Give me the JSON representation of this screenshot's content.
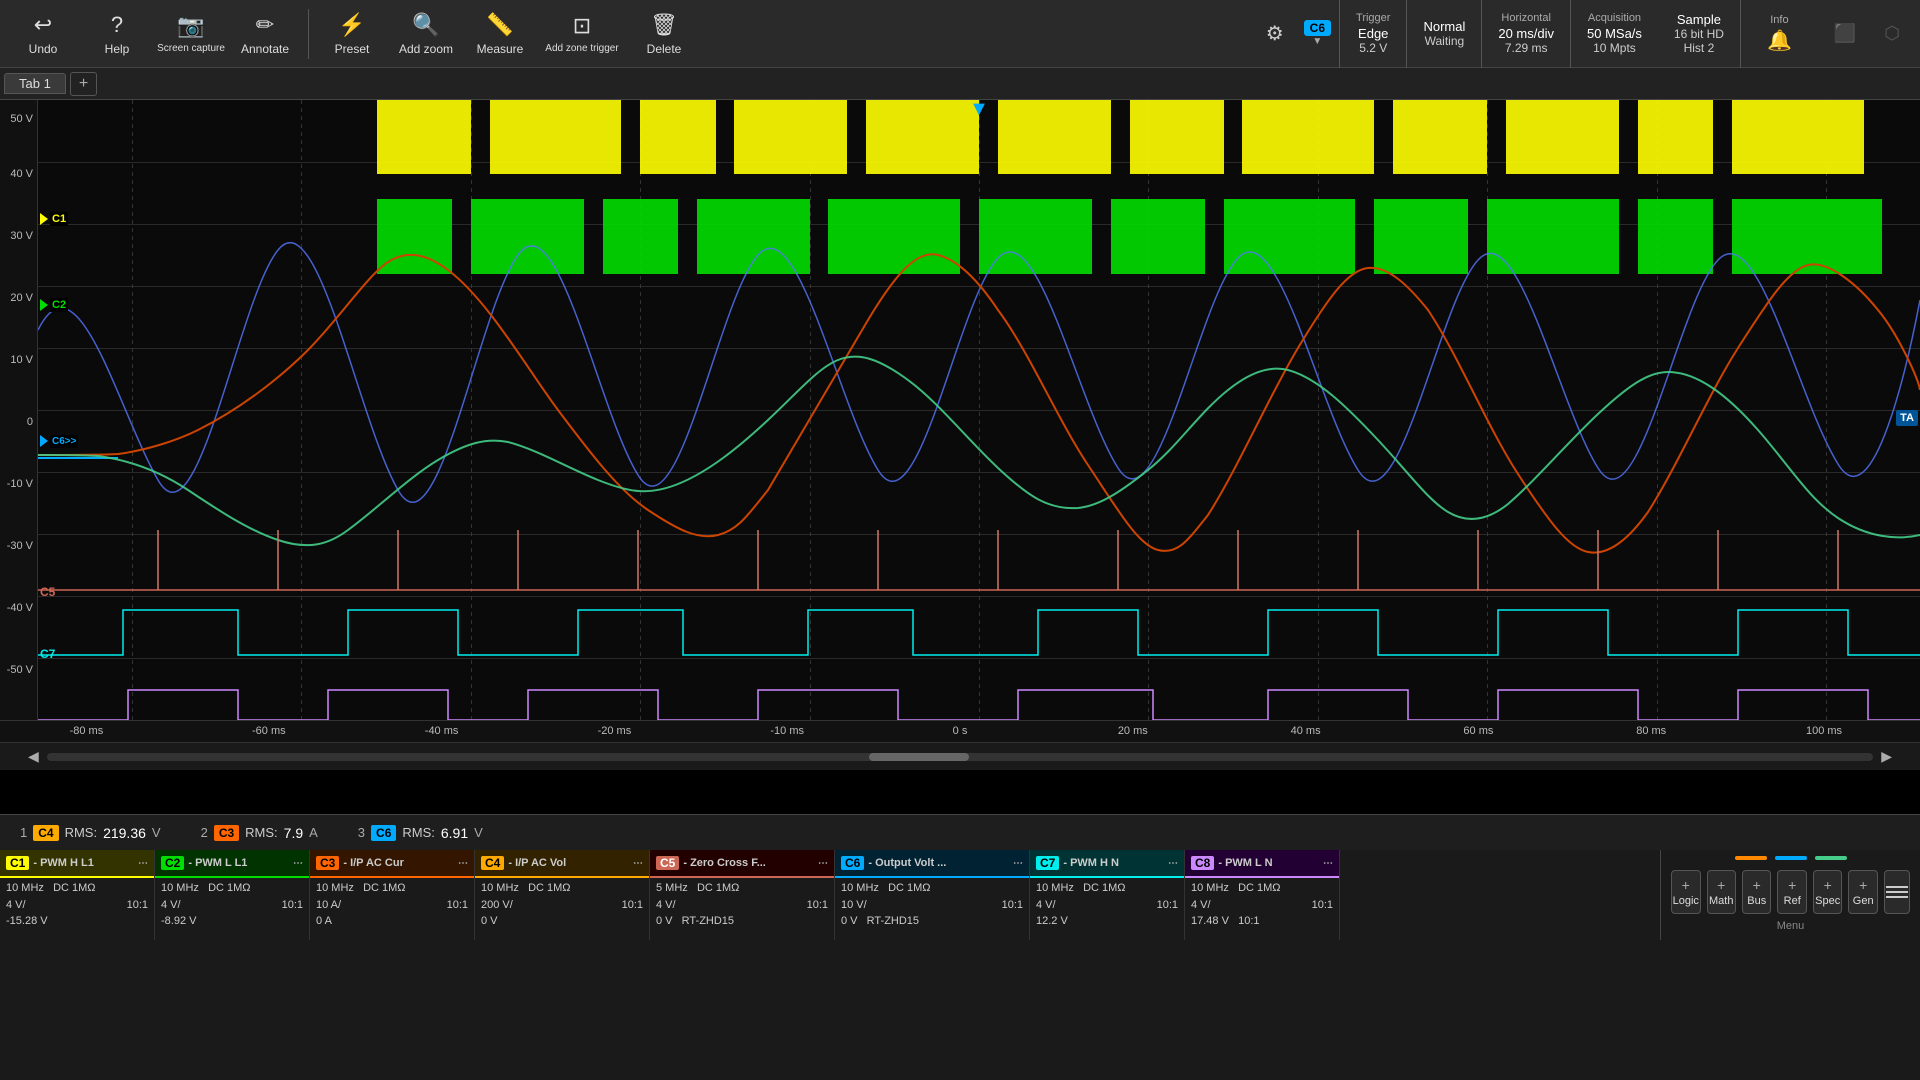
{
  "toolbar": {
    "undo_label": "Undo",
    "help_label": "Help",
    "screen_capture_label": "Screen capture",
    "annotate_label": "Annotate",
    "preset_label": "Preset",
    "add_zoom_label": "Add zoom",
    "measure_label": "Measure",
    "add_zone_trigger_label": "Add zone trigger",
    "delete_label": "Delete"
  },
  "trigger": {
    "label": "Trigger",
    "type": "Edge",
    "level": "5.2 V",
    "mode": "Normal",
    "status": "Waiting",
    "channel": "C6"
  },
  "horizontal": {
    "label": "Horizontal",
    "scale": "20 ms/div",
    "position": "7.29 ms"
  },
  "acquisition": {
    "label": "Acquisition",
    "type": "Sample",
    "depth": "50 MSa/s",
    "bits": "10 Mpts",
    "hd": "16 bit HD",
    "hist": "Hist 2"
  },
  "info_label": "Info",
  "tab": {
    "name": "Tab 1"
  },
  "time_labels": [
    "-80 ms",
    "-60 ms",
    "-40 ms",
    "-20 ms",
    "0 s",
    "20 ms",
    "40 ms",
    "60 ms",
    "80 ms",
    "100 ms"
  ],
  "y_labels": [
    "50 V",
    "40 V",
    "30 V",
    "20 V",
    "10 V",
    "0",
    "-10 V",
    "-20 V",
    "-30 V",
    "-40 V",
    "-50 V"
  ],
  "measurements": [
    {
      "index": "1",
      "channel": "C4",
      "channel_color": "#ffaa00",
      "type": "RMS:",
      "value": "219.36",
      "unit": "V"
    },
    {
      "index": "2",
      "channel": "C3",
      "channel_color": "#ff6600",
      "type": "RMS:",
      "value": "7.9",
      "unit": "A"
    },
    {
      "index": "3",
      "channel": "C6",
      "channel_color": "#00aaff",
      "type": "RMS:",
      "value": "6.91",
      "unit": "V"
    }
  ],
  "channels": [
    {
      "id": "C1",
      "name": "C1- PWM H L1",
      "color": "#ffff00",
      "bg": "#333300",
      "details": [
        "10 MHz",
        "DC 1MΩ",
        "4 V/",
        "10:1",
        "-15.28 V"
      ]
    },
    {
      "id": "C2",
      "name": "C2- PWM L L1",
      "color": "#00dd00",
      "bg": "#003300",
      "details": [
        "10 MHz",
        "DC 1MΩ",
        "4 V/",
        "10:1",
        "-8.92 V"
      ]
    },
    {
      "id": "C3",
      "name": "C3- I/P AC Cur",
      "color": "#ff6600",
      "bg": "#331500",
      "details": [
        "10 MHz",
        "DC 1MΩ",
        "10 A/",
        "10:1",
        "0 A"
      ]
    },
    {
      "id": "C4",
      "name": "C4- I/P AC Vol",
      "color": "#ffaa00",
      "bg": "#332200",
      "details": [
        "10 MHz",
        "DC 1MΩ",
        "200 V/",
        "10:1",
        "0 V"
      ]
    },
    {
      "id": "C5",
      "name": "C5- Zero Cross F...",
      "color": "#ff8888",
      "bg": "#330000",
      "details": [
        "5 MHz",
        "DC 1MΩ",
        "4 V/",
        "10:1",
        "0 V"
      ]
    },
    {
      "id": "C6",
      "name": "C6- Output Volt ...",
      "color": "#00aaff",
      "bg": "#002233",
      "details": [
        "10 MHz",
        "DC 1MΩ",
        "10 V/",
        "10:1",
        "0 V"
      ]
    },
    {
      "id": "C7",
      "name": "C7- PWM H N",
      "color": "#00eeee",
      "bg": "#003333",
      "details": [
        "10 MHz",
        "DC 1MΩ",
        "4 V/",
        "10:1",
        "12.2 V"
      ]
    },
    {
      "id": "C8",
      "name": "C8- PWM L N",
      "color": "#cc88ff",
      "bg": "#220033",
      "details": [
        "10 MHz",
        "DC 1MΩ",
        "4 V/",
        "10:1",
        "17.48 V"
      ]
    }
  ],
  "sidebar_buttons": [
    "Logic",
    "Math",
    "Bus",
    "Ref",
    "Spec",
    "Gen",
    "Menu"
  ],
  "legend_items": [
    {
      "color": "#ff8800",
      "label": ""
    },
    {
      "color": "#00aaff",
      "label": ""
    },
    {
      "color": "#00dd00",
      "label": ""
    }
  ],
  "math_label": "Math"
}
